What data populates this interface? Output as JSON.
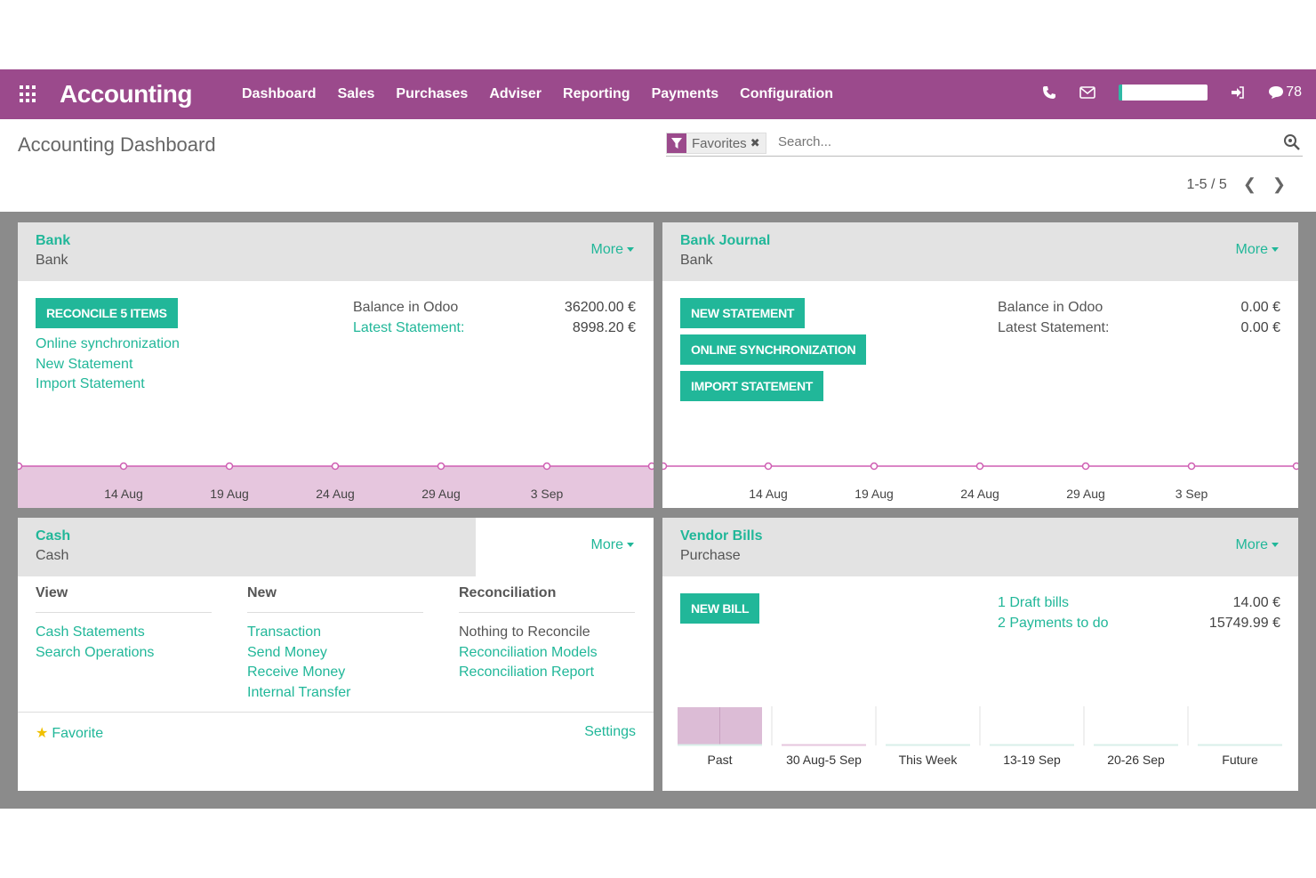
{
  "navbar": {
    "app_title": "Accounting",
    "menu": [
      "Dashboard",
      "Sales",
      "Purchases",
      "Adviser",
      "Reporting",
      "Payments",
      "Configuration"
    ],
    "message_count": "78",
    "brand_color": "#9b4a8c"
  },
  "control": {
    "page_title": "Accounting Dashboard",
    "facet_label": "Favorites",
    "search_placeholder": "Search...",
    "pager": "1-5 / 5"
  },
  "bank": {
    "title": "Bank",
    "subtitle": "Bank",
    "more": "More",
    "button": "Reconcile 5 Items",
    "links": [
      "Online synchronization",
      "New Statement",
      "Import Statement"
    ],
    "balance_label": "Balance in Odoo",
    "balance_value": "36200.00 €",
    "statement_label": "Latest Statement:",
    "statement_value": "8998.20 €",
    "chart_ticks": [
      "14 Aug",
      "19 Aug",
      "24 Aug",
      "29 Aug",
      "3 Sep"
    ]
  },
  "bank_journal": {
    "title": "Bank Journal",
    "subtitle": "Bank",
    "more": "More",
    "buttons": [
      "New Statement",
      "Online Synchronization",
      "Import Statement"
    ],
    "balance_label": "Balance in Odoo",
    "balance_value": "0.00 €",
    "statement_label": "Latest Statement:",
    "statement_value": "0.00 €",
    "chart_ticks": [
      "14 Aug",
      "19 Aug",
      "24 Aug",
      "29 Aug",
      "3 Sep"
    ]
  },
  "cash": {
    "title": "Cash",
    "subtitle": "Cash",
    "more": "More",
    "col_view": "View",
    "col_new": "New",
    "col_reconciliation": "Reconciliation",
    "view_links": [
      "Cash Statements",
      "Search Operations"
    ],
    "new_links": [
      "Transaction",
      "Send Money",
      "Receive Money",
      "Internal Transfer"
    ],
    "reconcile_text": "Nothing to Reconcile",
    "reconcile_links": [
      "Reconciliation Models",
      "Reconciliation Report"
    ],
    "favorite": "Favorite",
    "settings": "Settings"
  },
  "vendor_bills": {
    "title": "Vendor Bills",
    "subtitle": "Purchase",
    "more": "More",
    "button": "New Bill",
    "draft_link": "1 Draft bills",
    "draft_value": "14.00 €",
    "payments_link": "2 Payments to do",
    "payments_value": "15749.99 €"
  },
  "chart_data": {
    "type": "bar",
    "categories": [
      "Past",
      "30 Aug-5 Sep",
      "This Week",
      "13-19 Sep",
      "20-26 Sep",
      "Future"
    ],
    "values": [
      1,
      0,
      0,
      0,
      0,
      0
    ],
    "title": "",
    "xlabel": "",
    "ylabel": "",
    "bar_color": "#dcbcd6",
    "line_color": "#cf5fb3",
    "accent_color": "#21b799"
  }
}
